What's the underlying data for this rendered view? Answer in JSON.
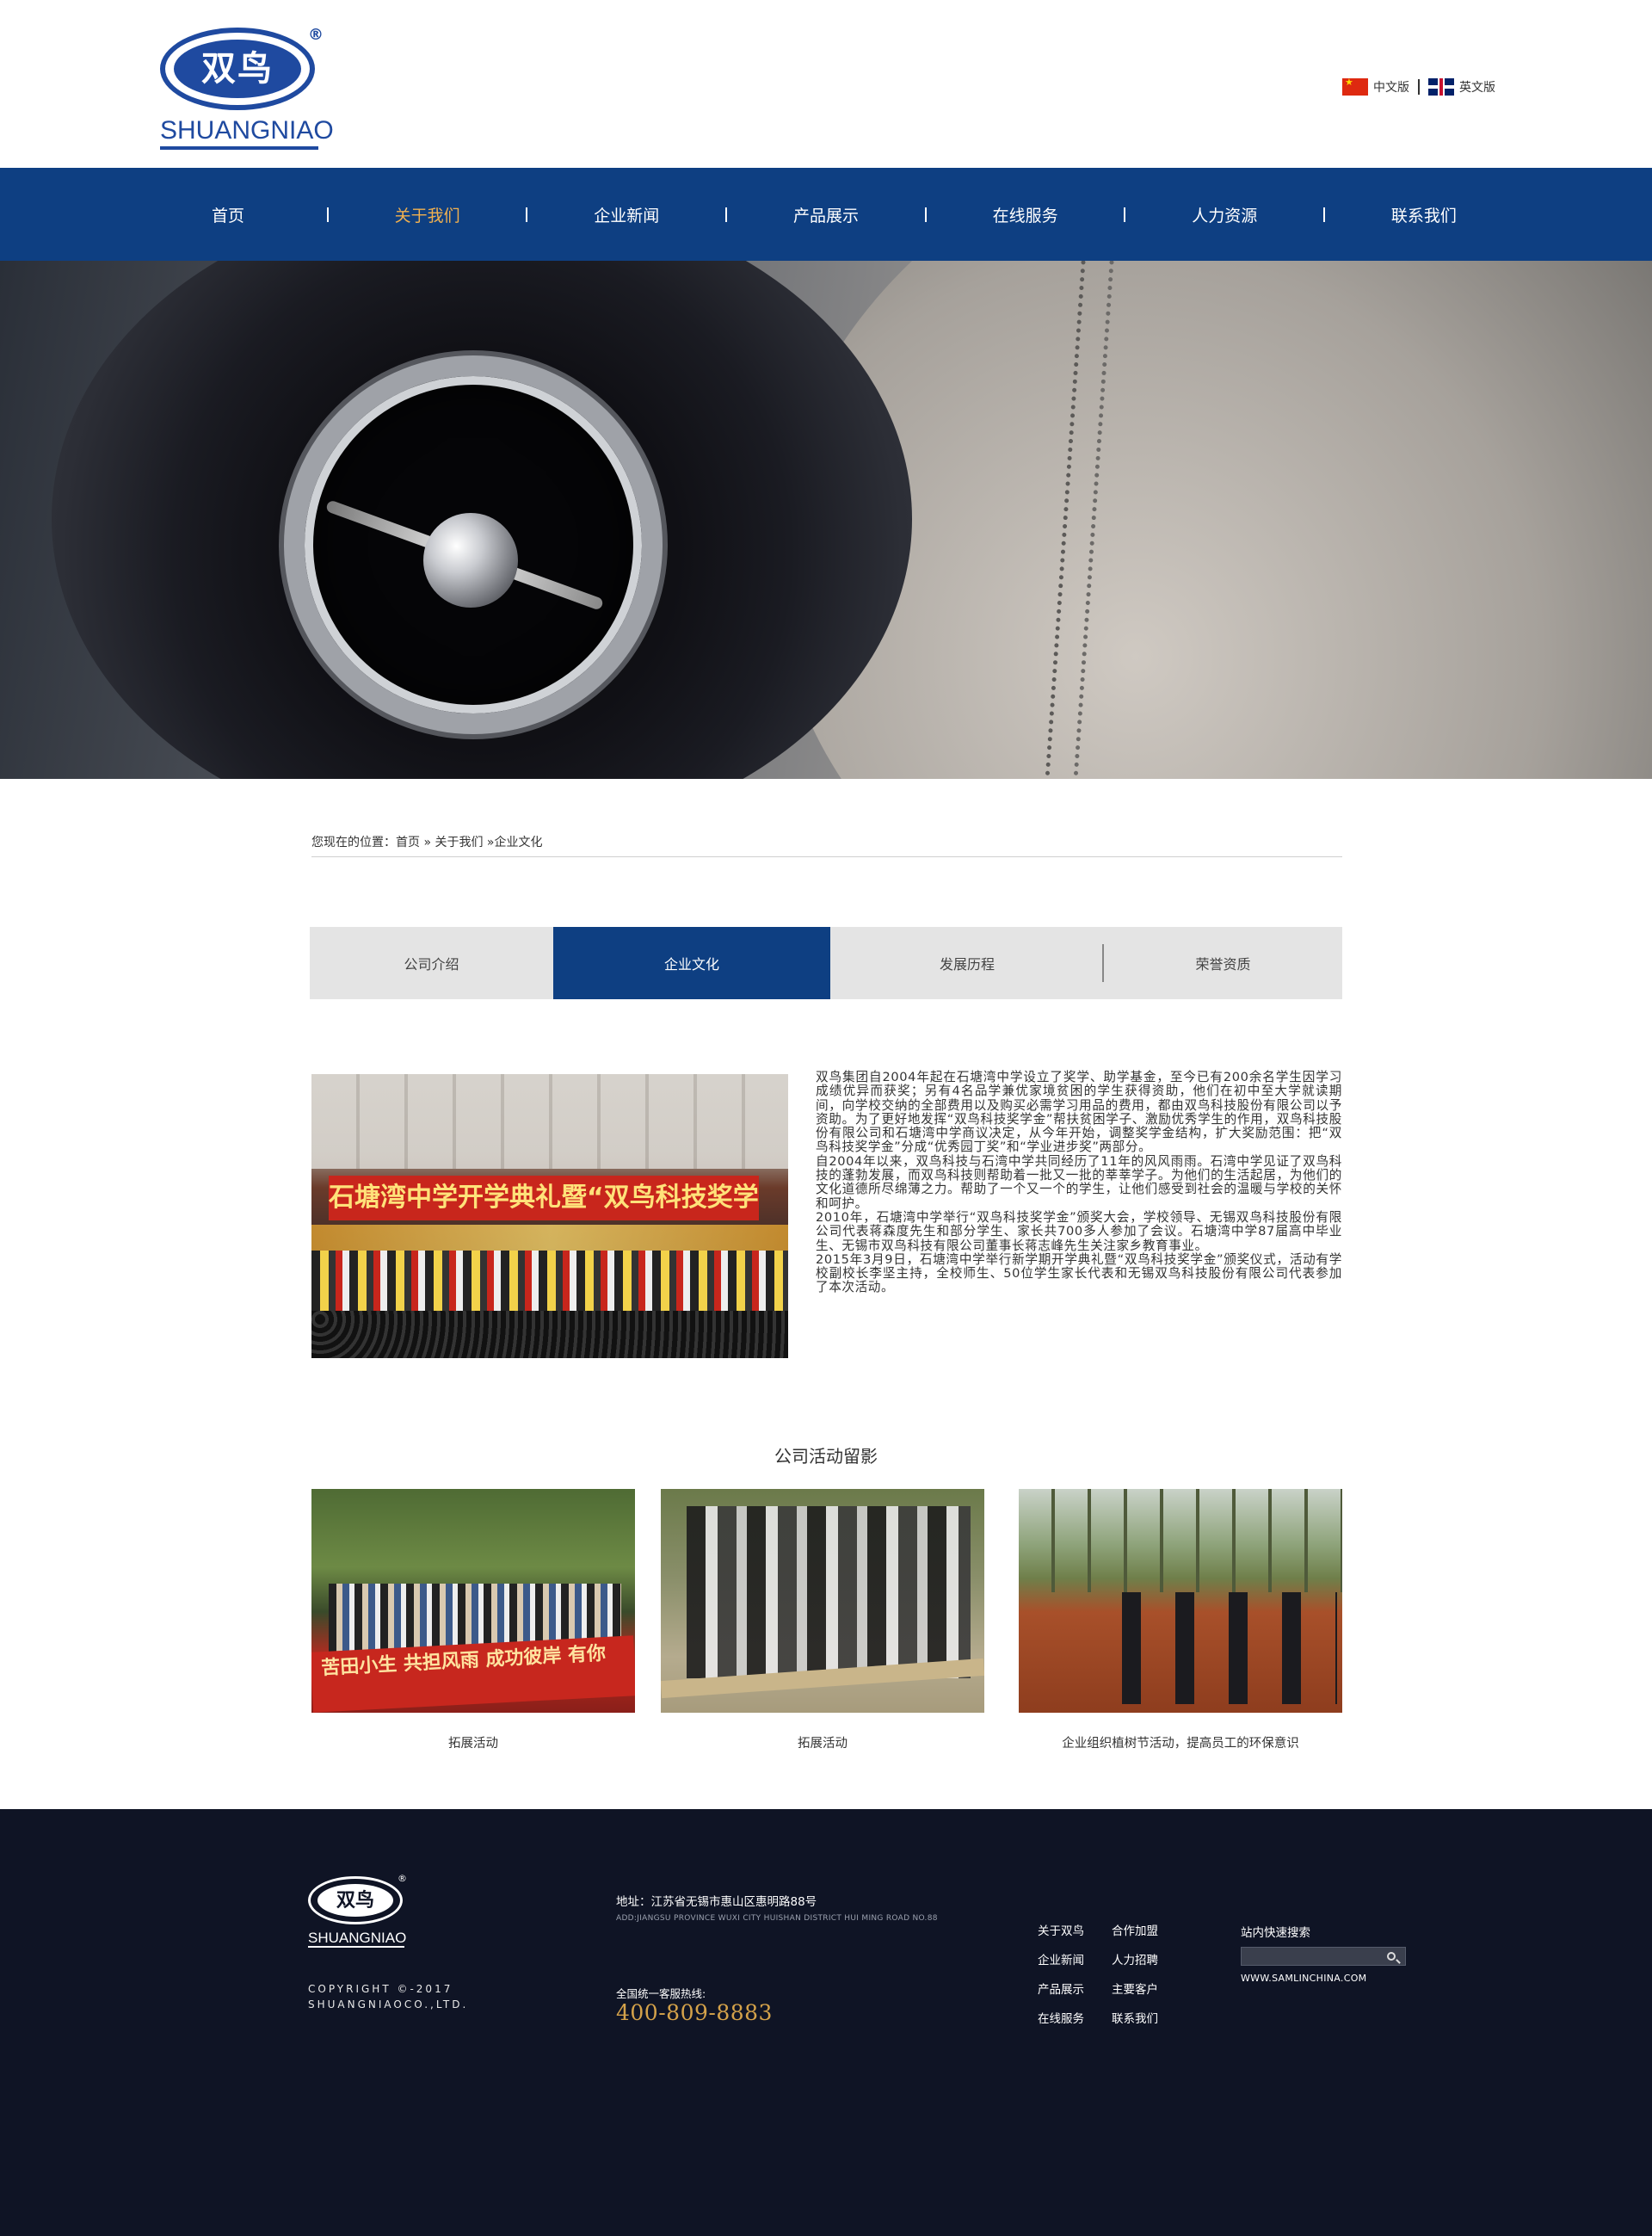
{
  "header": {
    "logo_cn": "双鸟",
    "logo_en": "SHUANGNIAO",
    "logo_reg": "®",
    "lang_cn": "中文版",
    "lang_en": "英文版"
  },
  "nav": {
    "items": [
      {
        "label": "首页"
      },
      {
        "label": "关于我们",
        "active": true
      },
      {
        "label": "企业新闻"
      },
      {
        "label": "产品展示"
      },
      {
        "label": "在线服务"
      },
      {
        "label": "人力资源"
      },
      {
        "label": "联系我们"
      }
    ],
    "accent_color": "#f0b050",
    "bg_color": "#0e3f82"
  },
  "breadcrumb": {
    "text": "您现在的位置：首页 » 关于我们 »企业文化"
  },
  "tabs": [
    {
      "label": "公司介绍"
    },
    {
      "label": "企业文化",
      "active": true
    },
    {
      "label": "发展历程"
    },
    {
      "label": "荣誉资质"
    }
  ],
  "intro": {
    "photo_banner": "石塘湾中学开学典礼暨“双鸟科技奖学金”颁奖仪式",
    "paragraphs": [
      "双鸟集团自2004年起在石塘湾中学设立了奖学、助学基金，至今已有200余名学生因学习成绩优异而获奖；另有4名品学兼优家境贫困的学生获得资助，他们在初中至大学就读期间，向学校交纳的全部费用以及购买必需学习用品的费用，都由双鸟科技股份有限公司以予资助。为了更好地发挥“双鸟科技奖学金”帮扶贫困学子、激励优秀学生的作用，双鸟科技股份有限公司和石塘湾中学商议决定，从今年开始，调整奖学金结构，扩大奖励范围：把“双鸟科技奖学金”分成“优秀园丁奖”和“学业进步奖”两部分。",
      "自2004年以来，双鸟科技与石湾中学共同经历了11年的风风雨雨。石湾中学见证了双鸟科技的蓬勃发展，而双鸟科技则帮助着一批又一批的莘莘学子。为他们的生活起居，为他们的文化道德所尽绵薄之力。帮助了一个又一个的学生，让他们感受到社会的温暖与学校的关怀和呵护。",
      "2010年，石塘湾中学举行“双鸟科技奖学金”颁奖大会，学校领导、无锡双鸟科技股份有限公司代表蒋森度先生和部分学生、家长共700多人参加了会议。石塘湾中学87届高中毕业生、无锡市双鸟科技有限公司董事长蒋志峰先生关注家乡教育事业。",
      "2015年3月9日，石塘湾中学举行新学期开学典礼暨“双鸟科技奖学金”颁奖仪式，活动有学校副校长李坚主持，全校师生、50位学生家长代表和无锡双鸟科技股份有限公司代表参加了本次活动。"
    ]
  },
  "activities": {
    "title": "公司活动留影",
    "items": [
      {
        "caption": "拓展活动",
        "banner": "苦田小生 共担风雨 成功彼岸 有你"
      },
      {
        "caption": "拓展活动"
      },
      {
        "caption": "企业组织植树节活动，提高员工的环保意识"
      }
    ]
  },
  "footer": {
    "logo_cn": "双鸟",
    "logo_en": "SHUANGNIAO",
    "logo_reg": "®",
    "copyright_line1": "COPYRIGHT ©-2017",
    "copyright_line2": "SHUANGNIAOCO.,LTD.",
    "address": "地址：江苏省无锡市惠山区惠明路88号",
    "address_en": "ADD:JIANGSU PROVINCE WUXI CITY HUISHAN DISTRICT HUI MING ROAD NO.88",
    "hotline_label": "全国统一客服热线:",
    "hotline": "400-809-8883",
    "links": [
      "关于双鸟",
      "合作加盟",
      "企业新闻",
      "人力招聘",
      "产品展示",
      "主要客户",
      "在线服务",
      "联系我们"
    ],
    "search_label": "站内快速搜索",
    "search_placeholder": "",
    "site": "WWW.SAMLINCHINA.COM"
  }
}
